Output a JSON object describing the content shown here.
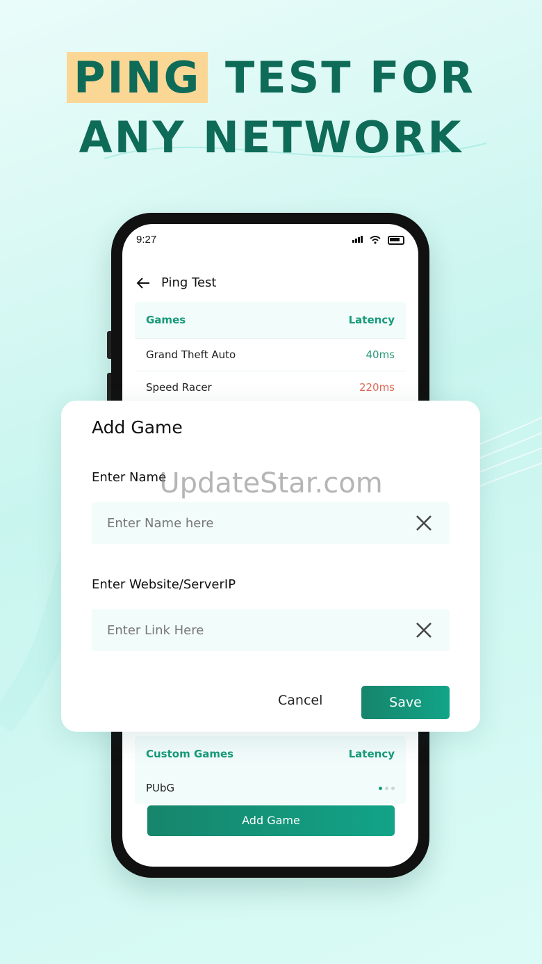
{
  "headline": {
    "line1_highlight": "PING",
    "line1_rest": " TEST FOR",
    "line2": "ANY NETWORK"
  },
  "status_bar": {
    "time": "9:27"
  },
  "appbar": {
    "title": "Ping Test"
  },
  "games_table": {
    "col_name": "Games",
    "col_latency": "Latency",
    "rows": [
      {
        "name": "Grand Theft Auto",
        "latency": "40ms"
      },
      {
        "name": "Speed Racer",
        "latency": "220ms"
      }
    ]
  },
  "custom_games": {
    "col_name": "Custom Games",
    "col_latency": "Latency",
    "rows": [
      {
        "name": "PUbG"
      }
    ]
  },
  "add_game_button": "Add Game",
  "dialog": {
    "title": "Add Game",
    "name_label": "Enter Name",
    "name_placeholder": "Enter Name here",
    "link_label": "Enter Website/ServerIP",
    "link_placeholder": "Enter Link Here",
    "cancel_label": "Cancel",
    "save_label": "Save"
  },
  "watermark": "UpdateStar.com",
  "colors": {
    "accent": "#179a7a",
    "headline": "#0e6b57",
    "highlight": "#fbd795",
    "bad_latency": "#e06b5a"
  }
}
